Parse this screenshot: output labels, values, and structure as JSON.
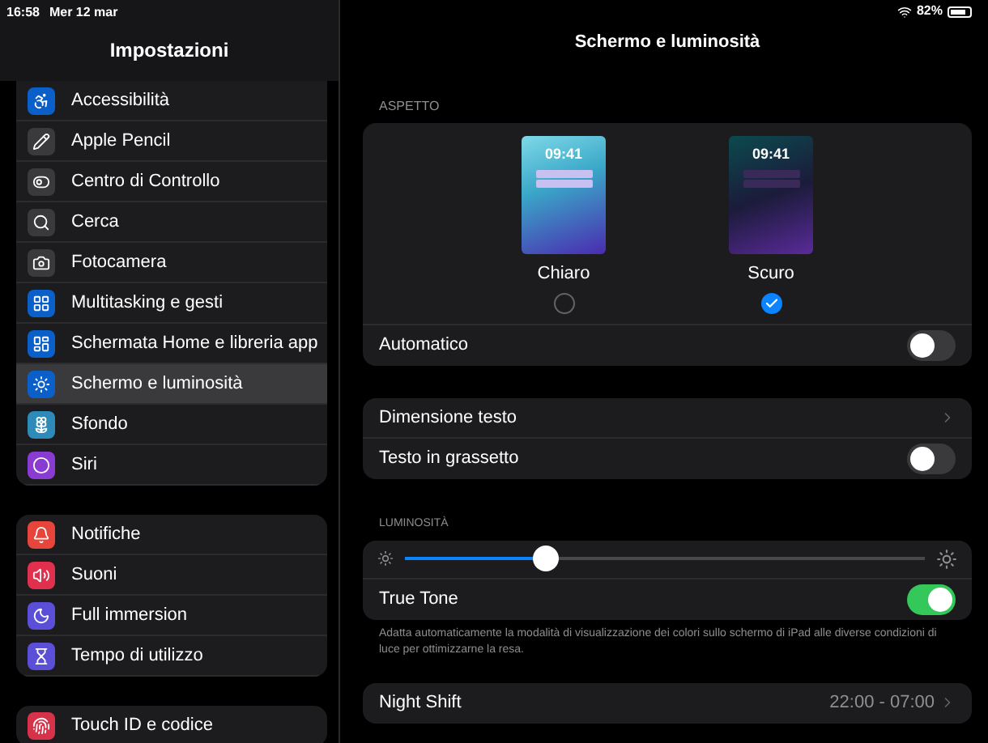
{
  "status_bar": {
    "time": "16:58",
    "date": "Mer 12 mar",
    "battery": "82%"
  },
  "sidebar": {
    "title": "Impostazioni",
    "groups": [
      {
        "items": [
          {
            "label": "Accessibilità",
            "selected": false
          },
          {
            "label": "Apple Pencil",
            "selected": false
          },
          {
            "label": "Centro di Controllo",
            "selected": false
          },
          {
            "label": "Cerca",
            "selected": false
          },
          {
            "label": "Fotocamera",
            "selected": false
          },
          {
            "label": "Multitasking e gesti",
            "selected": false
          },
          {
            "label": "Schermata Home e libreria app",
            "selected": false
          },
          {
            "label": "Schermo e luminosità",
            "selected": true
          },
          {
            "label": "Sfondo",
            "selected": false
          },
          {
            "label": "Siri",
            "selected": false
          }
        ]
      },
      {
        "items": [
          {
            "label": "Notifiche",
            "selected": false
          },
          {
            "label": "Suoni",
            "selected": false
          },
          {
            "label": "Full immersion",
            "selected": false
          },
          {
            "label": "Tempo di utilizzo",
            "selected": false
          }
        ]
      },
      {
        "items": [
          {
            "label": "Touch ID e codice",
            "selected": false
          }
        ]
      }
    ]
  },
  "main": {
    "title": "Schermo e luminosità",
    "appearance": {
      "header": "ASPETTO",
      "options": [
        {
          "label": "Chiaro",
          "time": "09:41",
          "selected": false
        },
        {
          "label": "Scuro",
          "time": "09:41",
          "selected": true
        }
      ],
      "automatic": {
        "label": "Automatico",
        "on": false
      }
    },
    "text_group": {
      "rows": [
        {
          "kind": "link",
          "label": "Dimensione testo"
        },
        {
          "kind": "toggle",
          "label": "Testo in grassetto",
          "on": false
        }
      ]
    },
    "brightness": {
      "header": "LUMINOSITÀ",
      "level": 0.27,
      "true_tone": {
        "label": "True Tone",
        "on": true
      },
      "footnote": "Adatta automaticamente la modalità di visualizzazione dei colori sullo schermo di iPad alle diverse condizioni di luce per ottimizzarne la resa."
    },
    "night_shift": {
      "label": "Night Shift",
      "value": "22:00 - 07:00"
    }
  }
}
